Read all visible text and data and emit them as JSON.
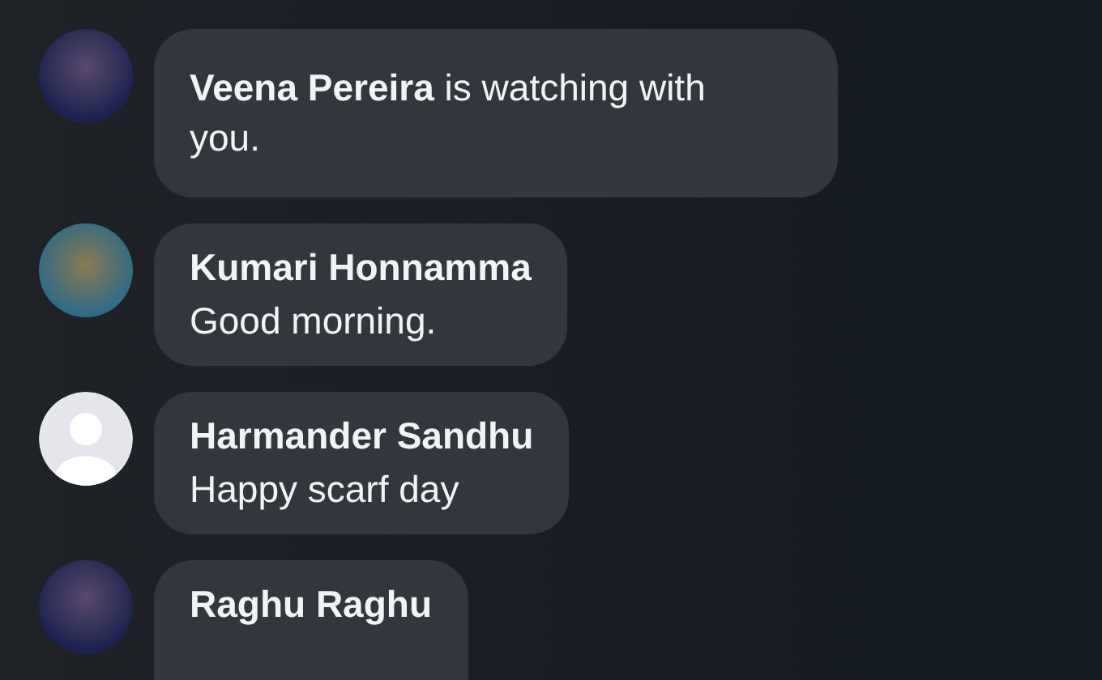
{
  "messages": [
    {
      "kind": "event",
      "has_photo": true,
      "text": "**Veena Pereira** is watching with you."
    },
    {
      "kind": "comment",
      "has_photo": true,
      "name": "Kumari Honnamma",
      "text": "Good morning."
    },
    {
      "kind": "comment",
      "has_photo": false,
      "name": "Harmander Sandhu",
      "text": "Happy scarf day"
    },
    {
      "kind": "comment",
      "has_photo": true,
      "name": "Raghu Raghu"
    }
  ]
}
